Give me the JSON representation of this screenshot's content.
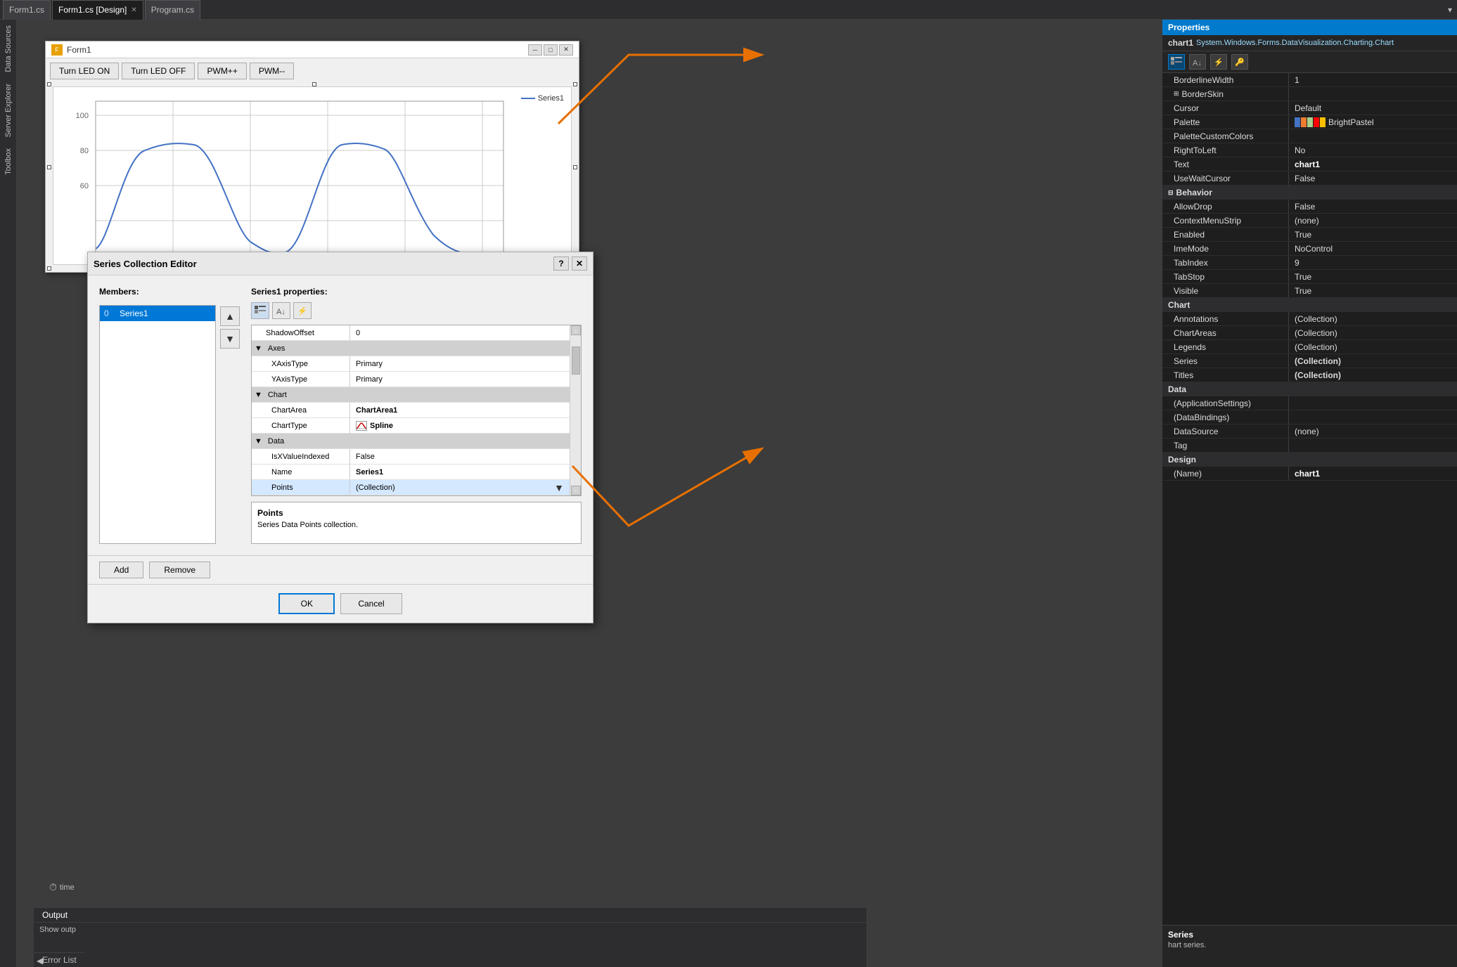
{
  "tabs": [
    {
      "label": "Form1.cs",
      "active": false,
      "closable": false
    },
    {
      "label": "Form1.cs [Design]",
      "active": true,
      "closable": true
    },
    {
      "label": "Program.cs",
      "active": false,
      "closable": false
    }
  ],
  "sidebar": {
    "items": [
      "Data Sources",
      "Server Explorer",
      "Toolbox"
    ]
  },
  "form": {
    "title": "Form1",
    "buttons": [
      "Turn LED ON",
      "Turn LED OFF",
      "PWM++",
      "PWM--"
    ],
    "chart_legend": "Series1"
  },
  "dialog": {
    "title": "Series Collection Editor",
    "help_btn": "?",
    "close_btn": "✕",
    "members_label": "Members:",
    "series_props_label": "Series1 properties:",
    "members": [
      {
        "index": "0",
        "name": "Series1",
        "selected": true
      }
    ],
    "series_properties": {
      "rows": [
        {
          "type": "prop",
          "name": "ShadowOffset",
          "value": "0",
          "indent": 0
        },
        {
          "type": "section",
          "name": "Axes",
          "collapsed": false
        },
        {
          "type": "prop",
          "name": "XAxisType",
          "value": "Primary",
          "indent": 1
        },
        {
          "type": "prop",
          "name": "YAxisType",
          "value": "Primary",
          "indent": 1
        },
        {
          "type": "section",
          "name": "Chart",
          "collapsed": false
        },
        {
          "type": "prop",
          "name": "ChartArea",
          "value": "ChartArea1",
          "bold": true,
          "indent": 1
        },
        {
          "type": "prop",
          "name": "ChartType",
          "value": "Spline",
          "bold": true,
          "indent": 1,
          "has_icon": true
        },
        {
          "type": "section",
          "name": "Data",
          "collapsed": false
        },
        {
          "type": "prop",
          "name": "IsXValueIndexed",
          "value": "False",
          "indent": 1
        },
        {
          "type": "prop",
          "name": "Name",
          "value": "Series1",
          "bold": true,
          "indent": 1
        },
        {
          "type": "prop",
          "name": "Points",
          "value": "(Collection)",
          "indent": 1,
          "selected": true
        }
      ],
      "description_title": "Points",
      "description_text": "Series Data Points collection."
    },
    "buttons": {
      "ok": "OK",
      "cancel": "Cancel",
      "add": "Add",
      "remove": "Remove"
    }
  },
  "properties": {
    "header": "Properties",
    "object_name": "chart1",
    "object_type": "System.Windows.Forms.DataVisualization.Charting.Chart",
    "rows": [
      {
        "name": "BorderlineWidth",
        "value": "1",
        "indent": 0
      },
      {
        "name": "BorderSkin",
        "value": "",
        "indent": 0,
        "section": false,
        "expandable": true
      },
      {
        "name": "Cursor",
        "value": "Default",
        "indent": 0
      },
      {
        "name": "Palette",
        "value": "BrightPastel",
        "indent": 0,
        "has_palette": true
      },
      {
        "name": "PaletteCustomColors",
        "value": "",
        "indent": 0
      },
      {
        "name": "RightToLeft",
        "value": "No",
        "indent": 0
      },
      {
        "name": "Text",
        "value": "chart1",
        "bold_value": true,
        "indent": 0
      },
      {
        "name": "UseWaitCursor",
        "value": "False",
        "indent": 0
      },
      {
        "section_title": "Behavior",
        "type": "section"
      },
      {
        "name": "AllowDrop",
        "value": "False",
        "indent": 0
      },
      {
        "name": "ContextMenuStrip",
        "value": "(none)",
        "indent": 0
      },
      {
        "name": "Enabled",
        "value": "True",
        "indent": 0
      },
      {
        "name": "ImeMode",
        "value": "NoControl",
        "indent": 0
      },
      {
        "name": "TabIndex",
        "value": "9",
        "indent": 0
      },
      {
        "name": "TabStop",
        "value": "True",
        "indent": 0
      },
      {
        "name": "Visible",
        "value": "True",
        "indent": 0
      },
      {
        "section_title": "Chart",
        "type": "section"
      },
      {
        "name": "Annotations",
        "value": "(Collection)",
        "indent": 0
      },
      {
        "name": "ChartAreas",
        "value": "(Collection)",
        "indent": 0
      },
      {
        "name": "Legends",
        "value": "(Collection)",
        "indent": 0
      },
      {
        "name": "Series",
        "value": "(Collection)",
        "bold_value": true,
        "indent": 0
      },
      {
        "name": "Titles",
        "value": "(Collection)",
        "bold_value": true,
        "indent": 0
      },
      {
        "section_title": "Data",
        "type": "section"
      },
      {
        "name": "(ApplicationSettings)",
        "value": "",
        "indent": 0
      },
      {
        "name": "(DataBindings)",
        "value": "",
        "indent": 0
      },
      {
        "name": "DataSource",
        "value": "(none)",
        "indent": 0
      },
      {
        "name": "Tag",
        "value": "",
        "indent": 0
      },
      {
        "section_title": "Design",
        "type": "section"
      },
      {
        "name": "(Name)",
        "value": "chart1",
        "bold_value": true,
        "indent": 0
      }
    ],
    "bottom_text": "Series\nhart series."
  },
  "bottom": {
    "output_tab": "Output",
    "show_output": "Show outp",
    "error_list_tab": "Error List"
  },
  "timer_label": "time",
  "palette_colors": [
    "#4472C4",
    "#ED7D31",
    "#A9D18E",
    "#FF0000",
    "#FFC000",
    "#5B9BD5",
    "#70AD47",
    "#255E91"
  ]
}
